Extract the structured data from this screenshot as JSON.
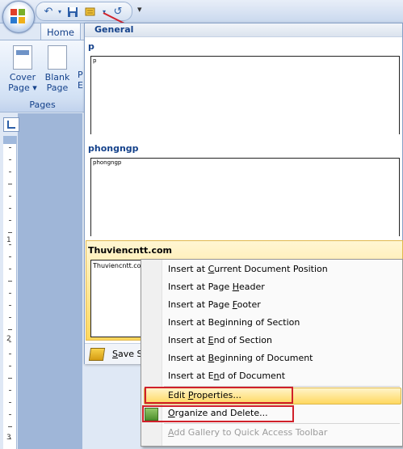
{
  "qat": {
    "icons": [
      "office-orb",
      "undo-icon",
      "save-icon",
      "quick-parts-icon",
      "redo-icon",
      "customize-toolbar-icon"
    ],
    "more": "▾"
  },
  "ribbon": {
    "tab_home": "Home",
    "buttons": [
      {
        "line1": "Cover",
        "line2": "Page ▾"
      },
      {
        "line1": "Blank",
        "line2": "Page"
      }
    ],
    "cut1": "P",
    "cut2": "E",
    "group_label": "Pages"
  },
  "ruler": {
    "numbers": [
      "1",
      "2",
      "3"
    ]
  },
  "gallery": {
    "header": "General",
    "items": [
      {
        "title": "p",
        "preview": "p"
      },
      {
        "title": "phongngp",
        "preview": "phongngp"
      },
      {
        "title": "Thuviencntt.com",
        "preview": "Thuviencntt.com"
      }
    ],
    "footer": {
      "prefix": "",
      "underline": "S",
      "rest": "ave Se"
    }
  },
  "menu": {
    "items": [
      {
        "pre": "Insert at ",
        "u": "C",
        "post": "urrent Document Position"
      },
      {
        "pre": "Insert at Page ",
        "u": "H",
        "post": "eader"
      },
      {
        "pre": "Insert at Page ",
        "u": "F",
        "post": "ooter"
      },
      {
        "pre": "Insert at Be",
        "u": "g",
        "post": "inning of Section"
      },
      {
        "pre": "Insert at ",
        "u": "E",
        "post": "nd of Section"
      },
      {
        "pre": "Insert at ",
        "u": "B",
        "post": "eginning of Document"
      },
      {
        "pre": "Insert at E",
        "u": "n",
        "post": "d of Document"
      },
      {
        "pre": "Edit ",
        "u": "P",
        "post": "roperties..."
      },
      {
        "pre": "",
        "u": "O",
        "post": "rganize and Delete..."
      },
      {
        "pre": "",
        "u": "A",
        "post": "dd Gallery to Quick Access Toolbar"
      }
    ]
  },
  "colors": {
    "annotation_red": "#d0202a",
    "highlight": "#ffd85f",
    "ribbon_text": "#15428b"
  }
}
